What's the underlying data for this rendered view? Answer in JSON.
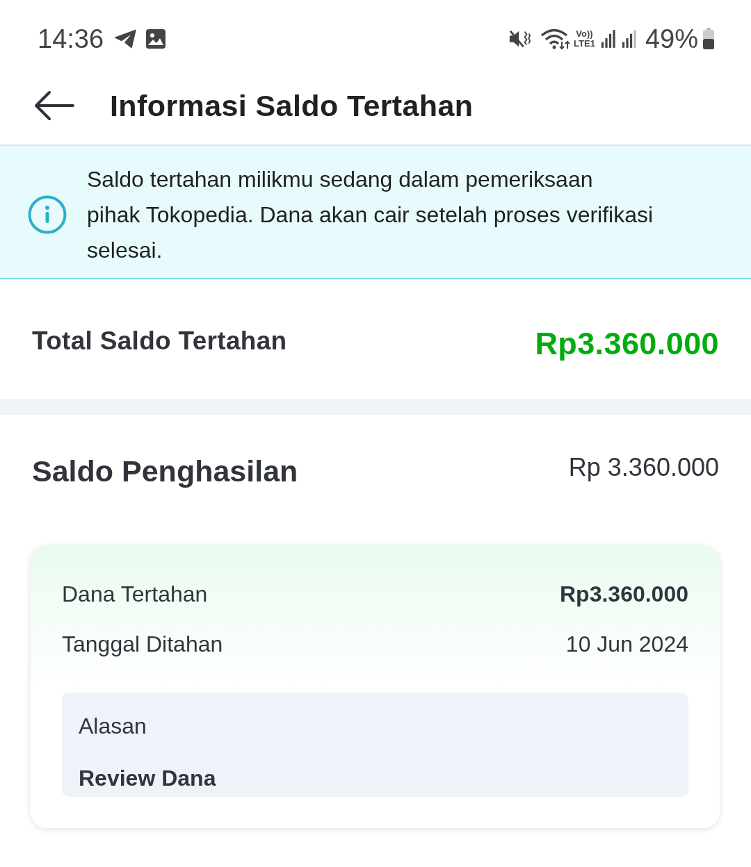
{
  "status_bar": {
    "time": "14:36",
    "network_label": [
      "Vo))",
      "LTE1"
    ],
    "battery": "49%"
  },
  "header": {
    "title": "Informasi Saldo Tertahan"
  },
  "info_banner": {
    "text": "Saldo tertahan milikmu sedang dalam pemeriksaan\npihak Tokopedia. Dana akan cair setelah proses verifikasi selesai."
  },
  "total": {
    "label": "Total Saldo Tertahan",
    "amount": "Rp3.360.000"
  },
  "section": {
    "title": "Saldo Penghasilan",
    "amount": "Rp 3.360.000",
    "card": {
      "rows": [
        {
          "label": "Dana Tertahan",
          "value": "Rp3.360.000",
          "kind": "emphasis"
        },
        {
          "label": "Tanggal Ditahan",
          "value": "10 Jun 2024",
          "kind": "plain"
        }
      ],
      "reason": {
        "label": "Alasan",
        "value": "Review Dana"
      }
    }
  }
}
